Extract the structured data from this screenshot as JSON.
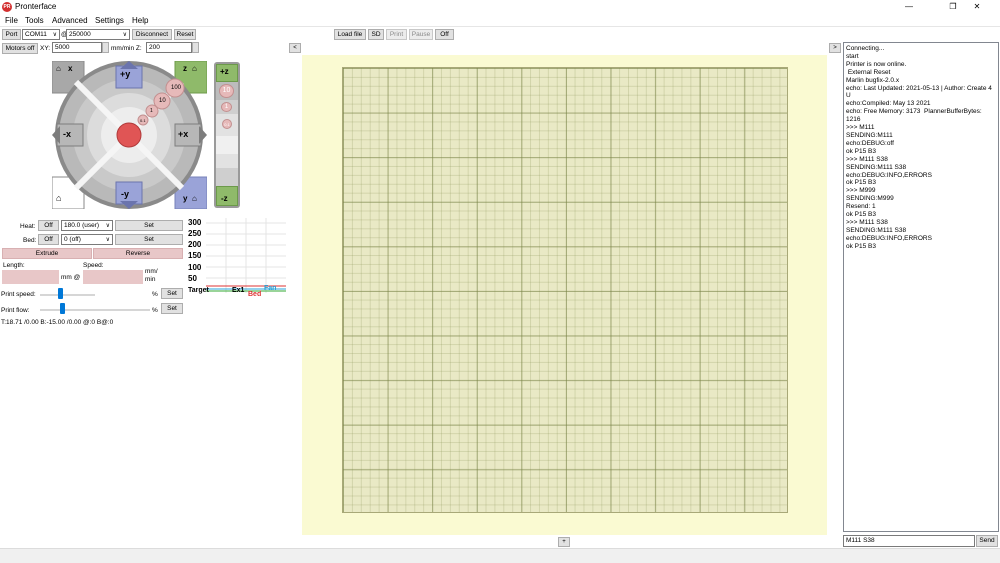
{
  "window": {
    "title": "Pronterface",
    "icon_text": "PR",
    "minimize": "—",
    "maximize": "❐",
    "close": "✕"
  },
  "menu": [
    "File",
    "Tools",
    "Advanced",
    "Settings",
    "Help"
  ],
  "connection": {
    "port_label": "Port",
    "port_value": "COM11",
    "at": "@",
    "baud_value": "250000",
    "disconnect": "Disconnect",
    "reset": "Reset"
  },
  "motion": {
    "motors_off": "Motors off",
    "xy_label": "XY:",
    "xy_value": "5000",
    "xy_unit": "mm/min Z:",
    "z_value": "200"
  },
  "jog": {
    "plus_y": "+y",
    "minus_y": "-y",
    "plus_x": "+x",
    "minus_x": "-x",
    "home_x": "x",
    "home_y": "y",
    "home_z": "z",
    "steps": [
      "100",
      "10",
      "1",
      "0.1"
    ],
    "z_up": "+z",
    "z_down": "-z",
    "z_steps": [
      "10",
      "1",
      "0.1"
    ]
  },
  "temps": {
    "heat_label": "Heat:",
    "heat_off": "Off",
    "heat_value": "180.0 (user)",
    "heat_set": "Set",
    "bed_label": "Bed:",
    "bed_off": "Off",
    "bed_value": "0 (off)",
    "bed_set": "Set"
  },
  "extrude": {
    "extrude": "Extrude",
    "reverse": "Reverse",
    "length_label": "Length:",
    "speed_label": "Speed:",
    "mm_at": "mm @",
    "mm_min": "mm/\nmin",
    "print_speed_label": "Print speed:",
    "print_flow_label": "Print flow:",
    "percent": "%",
    "set": "Set",
    "print_speed_level": 0.32,
    "print_flow_level": 0.33
  },
  "status_line": "T:18.71 /0.00 B:-15.00 /0.00 @:0 B@:0",
  "graph": {
    "y_ticks": [
      "300",
      "250",
      "200",
      "150",
      "100",
      "50"
    ],
    "legend": [
      "Target",
      "Ex1",
      "Bed",
      "Fan"
    ]
  },
  "toolbar": {
    "load_file": "Load file",
    "sd": "SD",
    "print": "Print",
    "pause": "Pause",
    "off": "Off",
    "collapse_left": "<",
    "collapse_right": ">",
    "collapse_bottom": "+"
  },
  "console": {
    "lines": [
      "Connecting...",
      "start",
      "Printer is now online.",
      " External Reset",
      "Marlin bugfix-2.0.x",
      "echo: Last Updated: 2021-05-13 | Author: Create 4 U",
      "echo:Compiled: May 13 2021",
      "echo: Free Memory: 3173  PlannerBufferBytes: 1216",
      ">>> M111",
      "SENDING:M111",
      "echo:DEBUG:off",
      "ok P15 B3",
      ">>> M111 S38",
      "SENDING:M111 S38",
      "echo:DEBUG:INFO,ERRORS",
      "ok P15 B3",
      ">>> M999",
      "SENDING:M999",
      "Resend: 1",
      "ok P15 B3",
      ">>> M111 S38",
      "SENDING:M111 S38",
      "echo:DEBUG:INFO,ERRORS",
      "ok P15 B3"
    ],
    "input_value": "M111 S38",
    "send": "Send"
  },
  "colors": {
    "plate_bg": "#fafad2",
    "grid": "#e9e9c5",
    "jog_green": "#7cb35c",
    "jog_blue": "#8f9bd2",
    "jog_red": "#e05555"
  }
}
